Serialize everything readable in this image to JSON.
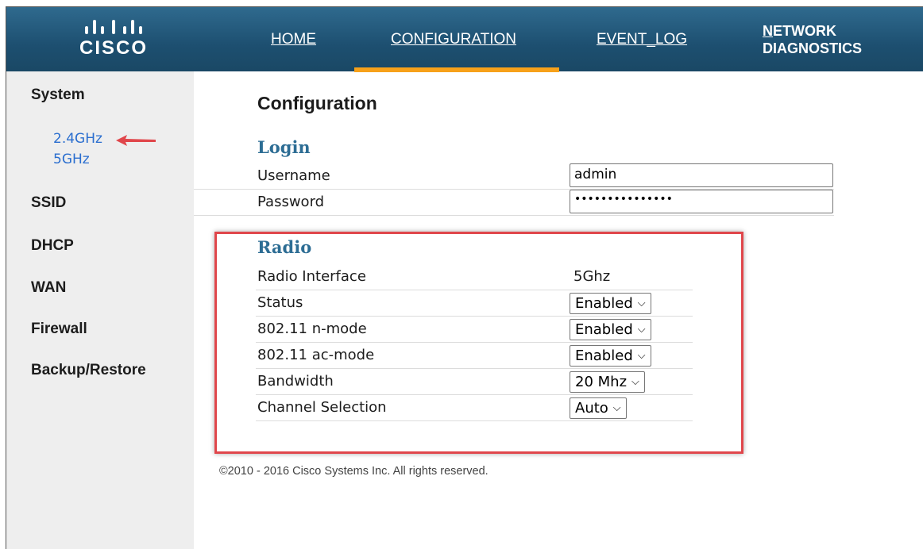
{
  "brand": {
    "logo_text": "CISCO"
  },
  "nav": {
    "home": "HOME",
    "configuration": "CONFIGURATION",
    "event_log": "EVENT_LOG",
    "network_first_letter": "N",
    "network_rest": "ETWORK",
    "diagnostics": "DIAGNOSTICS"
  },
  "sidebar": {
    "system": "System",
    "links": [
      "2.4GHz",
      "5GHz"
    ],
    "items": [
      "SSID",
      "DHCP",
      "WAN",
      "Firewall",
      "Backup/Restore"
    ]
  },
  "page": {
    "title": "Configuration"
  },
  "login": {
    "heading": "Login",
    "username_label": "Username",
    "username_value": "admin",
    "password_label": "Password",
    "password_value": "•••••••••••••••"
  },
  "radio": {
    "heading": "Radio",
    "rows": [
      {
        "label": "Radio Interface",
        "value": "5Ghz"
      },
      {
        "label": "Status",
        "value": "Enabled"
      },
      {
        "label": "802.11 n-mode",
        "value": "Enabled"
      },
      {
        "label": "802.11 ac-mode",
        "value": "Enabled"
      },
      {
        "label": "Bandwidth",
        "value": "20 Mhz"
      },
      {
        "label": "Channel Selection",
        "value": "Auto"
      }
    ]
  },
  "footer": {
    "copyright": "©2010 - 2016 Cisco Systems Inc. All rights reserved."
  },
  "colors": {
    "nav_bg": "#1d4f70",
    "active_tab": "#f7a11a",
    "link": "#2a6ecf",
    "section_heading": "#2d6d94",
    "highlight": "#e0464b"
  }
}
